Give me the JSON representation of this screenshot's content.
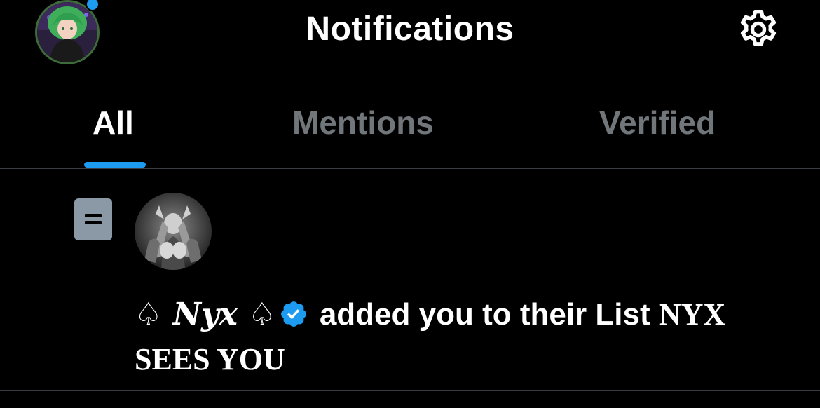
{
  "header": {
    "title": "Notifications",
    "avatar_icon": "profile-avatar",
    "settings_icon": "gear-icon"
  },
  "tabs": [
    {
      "label": "All",
      "active": true
    },
    {
      "label": "Mentions",
      "active": false
    },
    {
      "label": "Verified",
      "active": false
    }
  ],
  "notification": {
    "type_icon": "list-icon",
    "actor_avatar": "nyx-avatar",
    "actor_name_prefix": "♤",
    "actor_name": "𝑵𝒚𝒙",
    "actor_name_suffix": "♤",
    "verified_icon": "verified-badge-icon",
    "action_text": "added you to their List",
    "list_name": "NYX SEES YOU"
  },
  "colors": {
    "background": "#000000",
    "accent": "#1d9bf0",
    "text_primary": "#ffffff",
    "text_secondary": "#71767b",
    "divider": "#3a3d41"
  }
}
